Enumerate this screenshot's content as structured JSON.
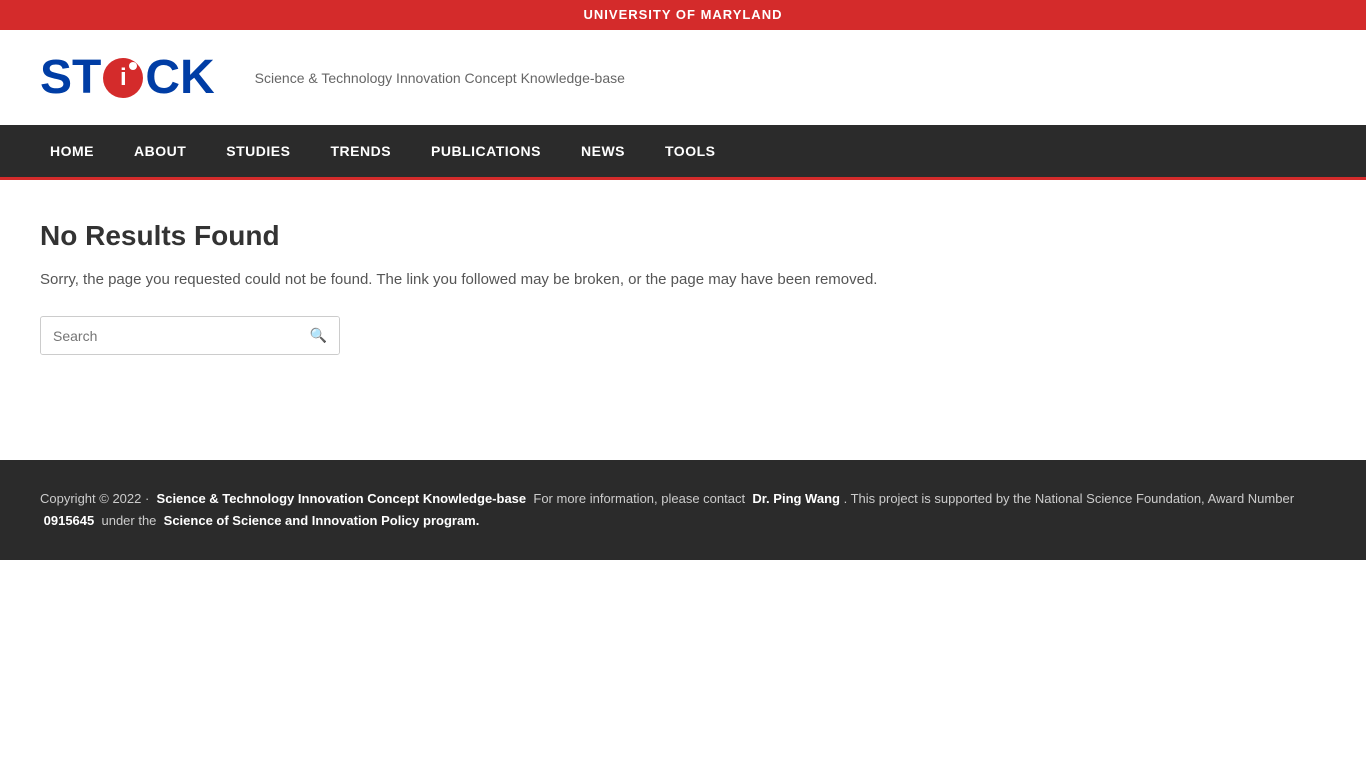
{
  "top_bar": {
    "text": "UNIVERSITY OF MARYLAND"
  },
  "header": {
    "logo_st": "ST",
    "logo_i": "i",
    "logo_ck": "CK",
    "tagline": "Science & Technology Innovation Concept Knowledge-base"
  },
  "navbar": {
    "items": [
      {
        "label": "HOME",
        "id": "home"
      },
      {
        "label": "ABOUT",
        "id": "about"
      },
      {
        "label": "STUDIES",
        "id": "studies"
      },
      {
        "label": "TRENDS",
        "id": "trends"
      },
      {
        "label": "PUBLICATIONS",
        "id": "publications"
      },
      {
        "label": "NEWS",
        "id": "news"
      },
      {
        "label": "TOOLS",
        "id": "tools"
      }
    ]
  },
  "main": {
    "error_title": "No Results Found",
    "error_description": "Sorry, the page you requested could not be found. The link you followed may be broken, or the page may have been removed.",
    "search_placeholder": "Search"
  },
  "footer": {
    "copyright": "Copyright © 2022 ·",
    "site_name": "Science & Technology Innovation Concept Knowledge-base",
    "contact_prefix": "For more information, please contact",
    "contact_name": "Dr. Ping Wang",
    "support_text": ". This project is supported by the National Science Foundation, Award Number",
    "award_number": "0915645",
    "program_prefix": "under the",
    "program_name": "Science of Science and Innovation Policy program."
  }
}
